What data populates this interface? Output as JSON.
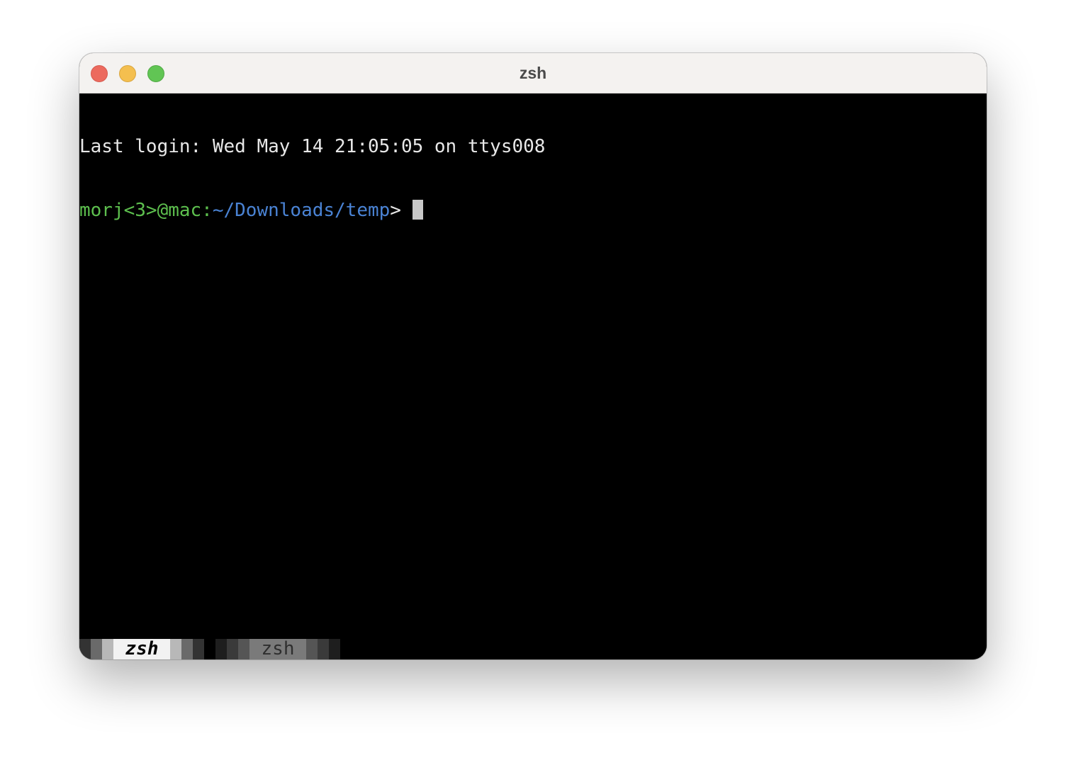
{
  "window": {
    "title": "zsh"
  },
  "terminal": {
    "login_line": "Last login: Wed May 14 21:05:05 on ttys008",
    "prompt_user": "morj<3>@mac:",
    "prompt_path": "~/Downloads/temp",
    "prompt_symbol": "> "
  },
  "tabs": [
    {
      "label": "zsh",
      "active": true
    },
    {
      "label": "zsh",
      "active": false
    }
  ],
  "colors": {
    "prompt_user": "#5dbf4e",
    "prompt_path": "#4a83d4",
    "background": "#000000"
  }
}
